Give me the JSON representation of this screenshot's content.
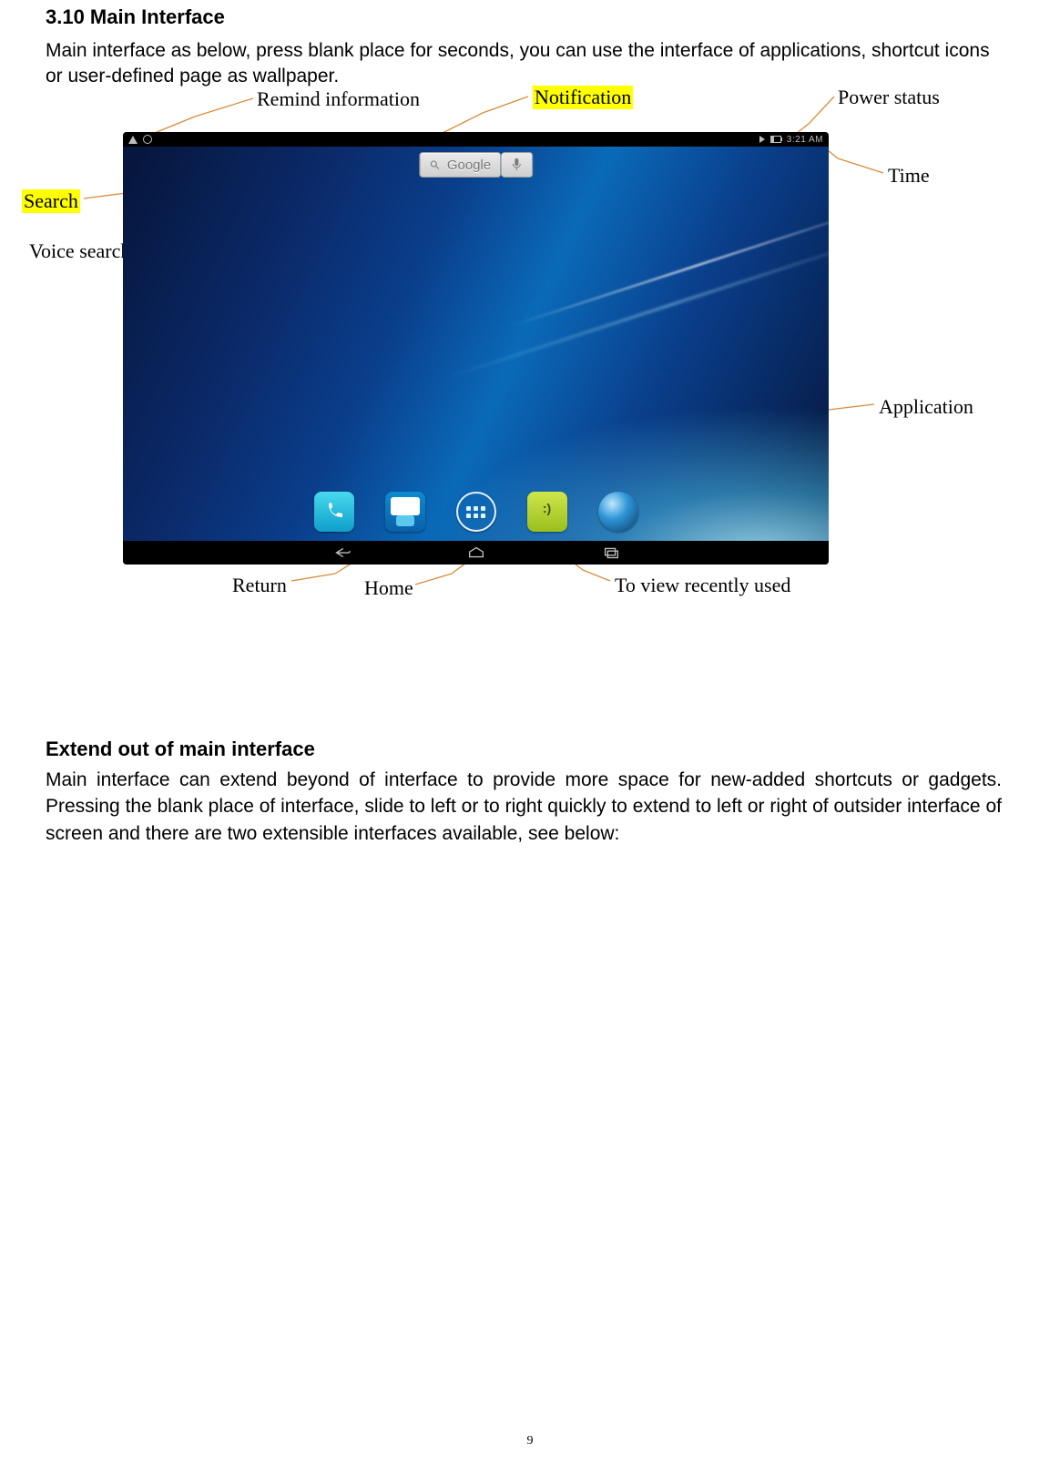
{
  "page_number": "9",
  "section": {
    "heading1": "3.10 Main Interface",
    "para1": "Main interface as below, press blank place for seconds, you can use the interface of applications, shortcut icons or user-defined page as wallpaper.",
    "heading2": "Extend out of main interface",
    "para2": "  Main interface can extend beyond of interface to provide more space for new-added shortcuts or gadgets. Pressing the blank place of interface, slide to left or to right quickly to extend to left or right of outsider interface of screen and there are two extensible interfaces available, see below:"
  },
  "callouts": {
    "remind_info": "Remind information",
    "notification": "Notification",
    "power_status": "Power status",
    "search": "Search",
    "time": "Time",
    "voice_search": "Voice search",
    "application": "Application",
    "return": "Return",
    "home": "Home",
    "recent": "To view recently used"
  },
  "device": {
    "status_time": "3:21 AM",
    "search_label": "Google",
    "icons": {
      "warning": "warning-icon",
      "usb": "usb-icon",
      "bluetooth": "bluetooth-icon",
      "battery": "battery-icon",
      "mic": "mic-icon",
      "phone": "phone-icon",
      "contacts": "contacts-icon",
      "apps": "apps-icon",
      "messaging": "messaging-icon",
      "browser": "browser-icon",
      "back": "back-icon",
      "home": "home-icon",
      "recents": "recents-icon"
    }
  }
}
